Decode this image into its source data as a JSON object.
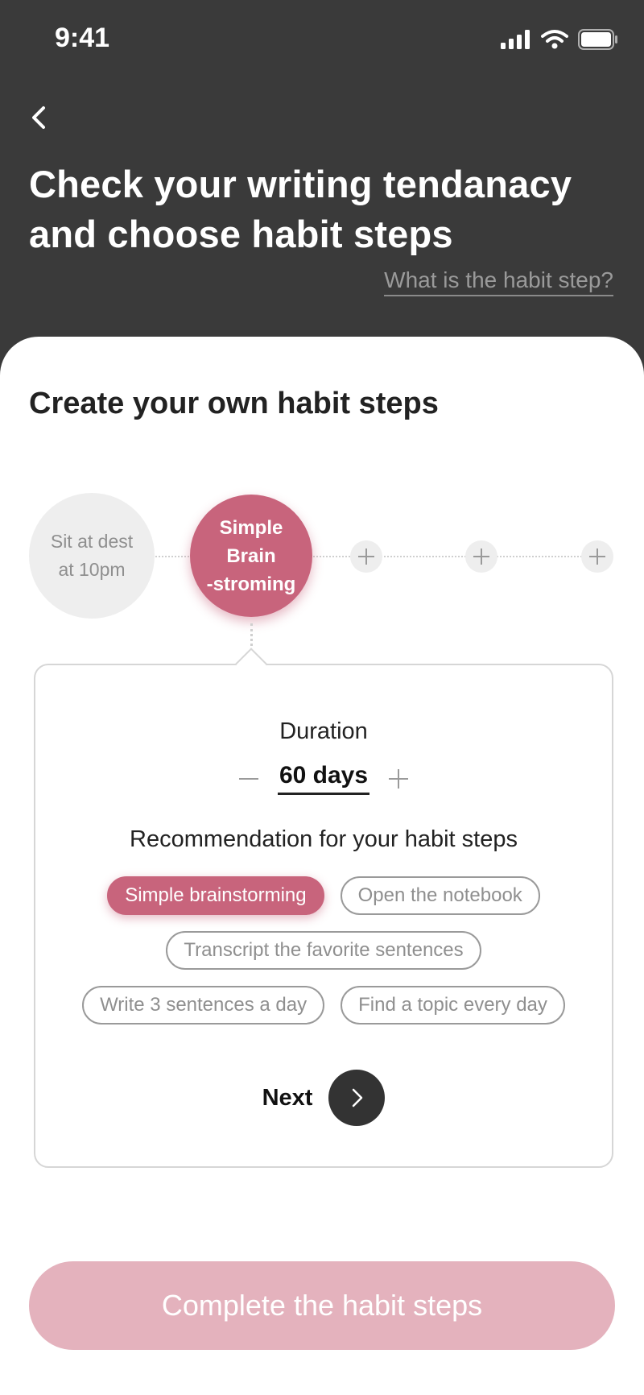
{
  "status_bar": {
    "time": "9:41"
  },
  "header": {
    "title_line1": "Check your writing tendanacy",
    "title_line2": "and choose habit steps",
    "help_link": "What is the habit step?"
  },
  "section": {
    "title": "Create your own habit steps"
  },
  "steps": {
    "completed": {
      "line1": "Sit at dest",
      "line2": "at 10pm"
    },
    "active": {
      "line1": "Simple",
      "line2": "Brain",
      "line3": "-stroming"
    }
  },
  "card": {
    "duration_label": "Duration",
    "duration_value": "60 days",
    "recommendation_label": "Recommendation for your habit steps",
    "chips": [
      "Simple brainstorming",
      "Open the notebook",
      "Transcript the favorite sentences",
      "Write 3 sentences a day",
      "Find a topic every day"
    ],
    "selected_chip": "Simple brainstorming",
    "next_label": "Next"
  },
  "footer": {
    "complete_label": "Complete the habit steps"
  },
  "colors": {
    "accent": "#c8647c",
    "accent_disabled": "#e4b2bd",
    "header_bg": "#3a3a3a"
  },
  "icons": [
    "back-chevron-icon",
    "signal-icon",
    "wifi-icon",
    "battery-icon",
    "plus-icon",
    "minus-icon",
    "chevron-right-icon"
  ]
}
